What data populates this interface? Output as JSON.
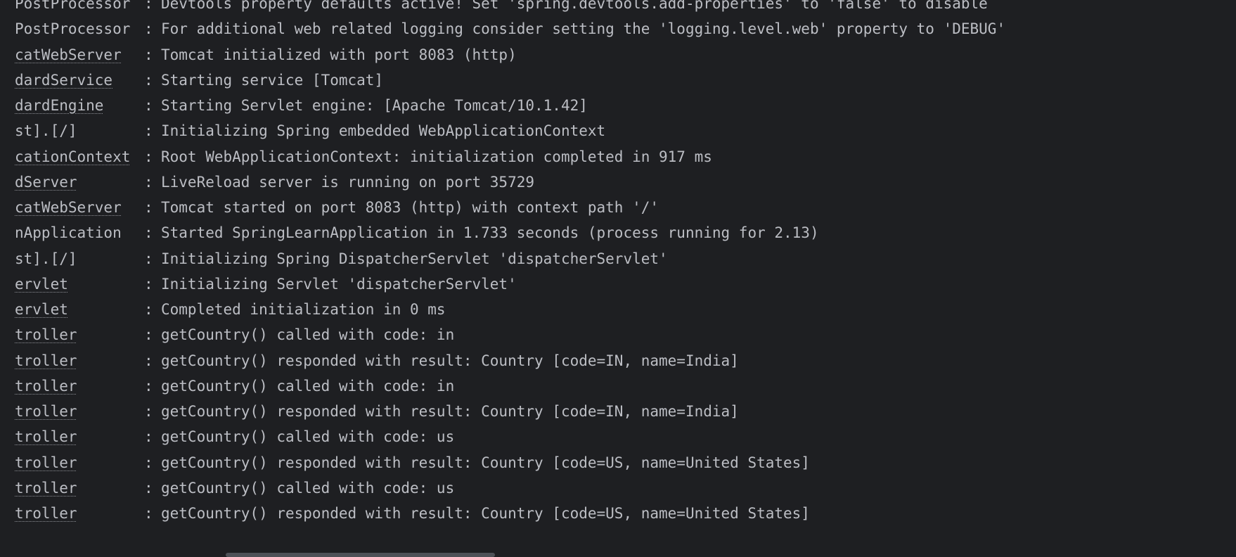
{
  "console": {
    "lines": [
      {
        "logger": "PostProcessor",
        "link": false,
        "message": "Devtools property defaults active! Set 'spring.devtools.add-properties' to 'false' to disable"
      },
      {
        "logger": "PostProcessor",
        "link": false,
        "message": "For additional web related logging consider setting the 'logging.level.web' property to 'DEBUG'"
      },
      {
        "logger": "catWebServer",
        "link": true,
        "message": "Tomcat initialized with port 8083 (http)"
      },
      {
        "logger": "dardService",
        "link": true,
        "message": "Starting service [Tomcat]"
      },
      {
        "logger": "dardEngine",
        "link": true,
        "message": "Starting Servlet engine: [Apache Tomcat/10.1.42]"
      },
      {
        "logger": "st].[/]",
        "link": false,
        "message": "Initializing Spring embedded WebApplicationContext"
      },
      {
        "logger": "cationContext",
        "link": true,
        "message": "Root WebApplicationContext: initialization completed in 917 ms"
      },
      {
        "logger": "dServer",
        "link": true,
        "message": "LiveReload server is running on port 35729"
      },
      {
        "logger": "catWebServer",
        "link": true,
        "message": "Tomcat started on port 8083 (http) with context path '/'"
      },
      {
        "logger": "nApplication",
        "link": false,
        "message": "Started SpringLearnApplication in 1.733 seconds (process running for 2.13)"
      },
      {
        "logger": "st].[/]",
        "link": false,
        "message": "Initializing Spring DispatcherServlet 'dispatcherServlet'"
      },
      {
        "logger": "ervlet",
        "link": true,
        "message": "Initializing Servlet 'dispatcherServlet'"
      },
      {
        "logger": "ervlet",
        "link": true,
        "message": "Completed initialization in 0 ms"
      },
      {
        "logger": "troller",
        "link": true,
        "message": "getCountry() called with code: in"
      },
      {
        "logger": "troller",
        "link": true,
        "message": "getCountry() responded with result: Country [code=IN, name=India]"
      },
      {
        "logger": "troller",
        "link": true,
        "message": "getCountry() called with code: in"
      },
      {
        "logger": "troller",
        "link": true,
        "message": "getCountry() responded with result: Country [code=IN, name=India]"
      },
      {
        "logger": "troller",
        "link": true,
        "message": "getCountry() called with code: us"
      },
      {
        "logger": "troller",
        "link": true,
        "message": "getCountry() responded with result: Country [code=US, name=United States]"
      },
      {
        "logger": "troller",
        "link": true,
        "message": "getCountry() called with code: us"
      },
      {
        "logger": "troller",
        "link": true,
        "message": "getCountry() responded with result: Country [code=US, name=United States]"
      }
    ],
    "separator": ":"
  },
  "colors": {
    "background": "#1e1f22",
    "text": "#bcbec4",
    "scrollbar_thumb": "#4e5157"
  }
}
